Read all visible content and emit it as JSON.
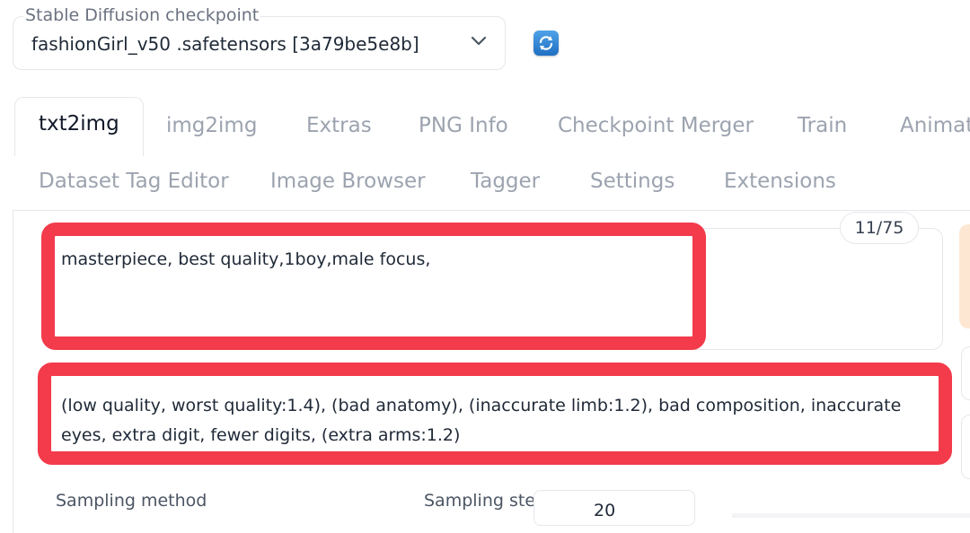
{
  "checkpoint": {
    "label": "Stable Diffusion checkpoint",
    "value": "fashionGirl_v50 .safetensors [3a79be5e8b]"
  },
  "tabs_row1": [
    "txt2img",
    "img2img",
    "Extras",
    "PNG Info",
    "Checkpoint Merger",
    "Train",
    "Animat"
  ],
  "tabs_row2": [
    "Dataset Tag Editor",
    "Image Browser",
    "Tagger",
    "Settings",
    "Extensions"
  ],
  "prompt": {
    "text": "masterpiece, best quality,1boy,male focus,",
    "token_count": "11/75"
  },
  "negative_prompt": {
    "text": "(low quality, worst quality:1.4), (bad anatomy), (inaccurate limb:1.2), bad composition, inaccurate eyes, extra digit, fewer digits, (extra arms:1.2)"
  },
  "sampling": {
    "method_label": "Sampling method",
    "steps_label": "Sampling steps",
    "steps_value": "20"
  },
  "colors": {
    "highlight": "#f33b4b",
    "accent_orange": "#fde7d2"
  }
}
